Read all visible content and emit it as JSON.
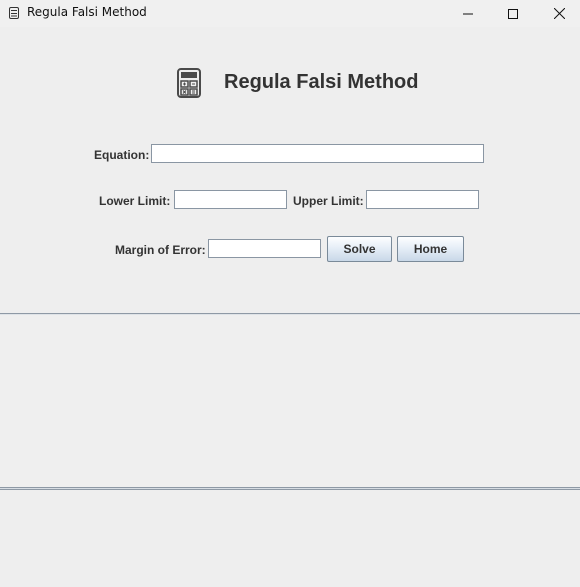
{
  "window": {
    "title": "Regula Falsi Method",
    "app_icon": "calculator-icon",
    "controls": [
      "minimize-icon",
      "maximize-icon",
      "close-icon"
    ]
  },
  "header": {
    "icon": "calculator-icon",
    "title": "Regula Falsi Method"
  },
  "form": {
    "equation_label": "Equation:",
    "equation_value": "",
    "lower_label": "Lower Limit:",
    "lower_value": "",
    "upper_label": "Upper Limit:",
    "upper_value": "",
    "error_label": "Margin of Error:",
    "error_value": "",
    "solve_label": "Solve",
    "home_label": "Home"
  },
  "results": {
    "content": ""
  },
  "colors": {
    "background": "#eeeeee",
    "text": "#333333",
    "separator": "#8e99a5",
    "button_top": "#fdfeff",
    "button_bottom": "#c9d8e8"
  }
}
